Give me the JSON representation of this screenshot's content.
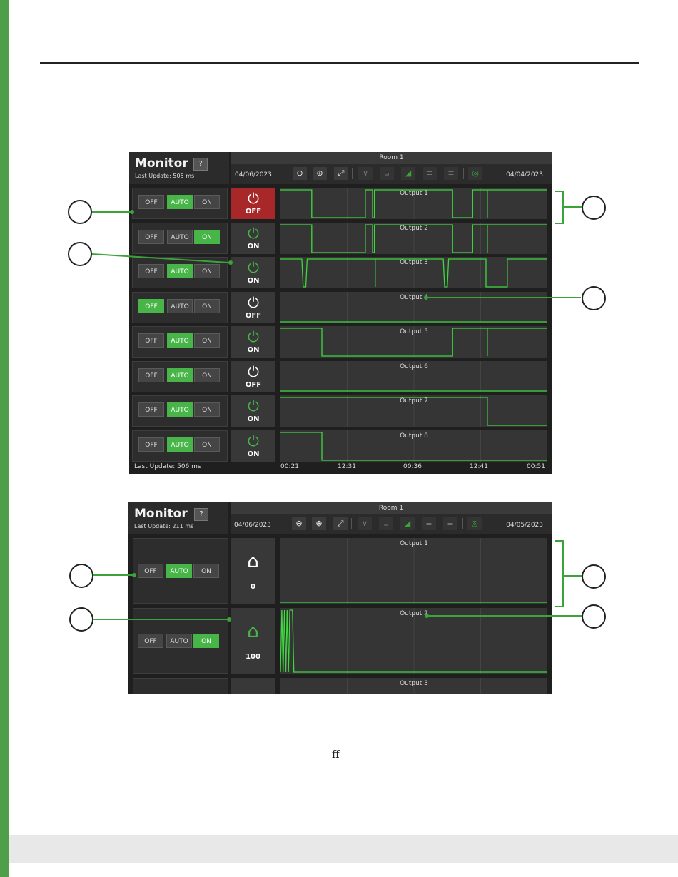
{
  "page": {
    "footer_text": "ff"
  },
  "monitor1": {
    "title": "Monitor",
    "help": "?",
    "last_update_top": "Last Update:  505 ms",
    "room": "Room 1",
    "date_left": "04/06/2023",
    "date_right": "04/04/2023",
    "last_update_bottom": "Last Update:  506 ms",
    "toolbar": [
      "zoom-out-icon",
      "zoom-in-icon",
      "fit-icon",
      "chart-line-icon",
      "chart-step-icon",
      "chart-area-icon",
      "list-icon",
      "legend-icon",
      "camera-icon"
    ],
    "x_ticks": [
      "00:21",
      "12:31",
      "00:36",
      "12:41",
      "00:51"
    ],
    "outputs": [
      {
        "name": "Output 1",
        "mode": "AUTO",
        "status": "OFF",
        "state": "off-red",
        "signal": [
          [
            0,
            1
          ],
          [
            0.117,
            1
          ],
          [
            0.117,
            0
          ],
          [
            0.318,
            0
          ],
          [
            0.318,
            1
          ],
          [
            0.345,
            1
          ],
          [
            0.345,
            0
          ],
          [
            0.352,
            0
          ],
          [
            0.352,
            1
          ],
          [
            0.645,
            1
          ],
          [
            0.645,
            0
          ],
          [
            0.72,
            0
          ],
          [
            0.72,
            1
          ],
          [
            0.775,
            1
          ],
          [
            0.775,
            0
          ],
          [
            0.775,
            1
          ],
          [
            1,
            1
          ]
        ]
      },
      {
        "name": "Output 2",
        "mode": "ON",
        "status": "ON",
        "state": "on",
        "signal": [
          [
            0,
            1
          ],
          [
            0.117,
            1
          ],
          [
            0.117,
            0
          ],
          [
            0.318,
            0
          ],
          [
            0.318,
            1
          ],
          [
            0.345,
            1
          ],
          [
            0.345,
            0
          ],
          [
            0.352,
            0
          ],
          [
            0.352,
            1
          ],
          [
            0.645,
            1
          ],
          [
            0.645,
            0
          ],
          [
            0.72,
            0
          ],
          [
            0.72,
            1
          ],
          [
            0.775,
            1
          ],
          [
            0.775,
            0
          ],
          [
            0.775,
            1
          ],
          [
            1,
            1
          ]
        ]
      },
      {
        "name": "Output 3",
        "mode": "AUTO",
        "status": "ON",
        "state": "on",
        "signal": [
          [
            0,
            1
          ],
          [
            0.08,
            1
          ],
          [
            0.085,
            0
          ],
          [
            0.095,
            0
          ],
          [
            0.1,
            1
          ],
          [
            0.355,
            1
          ],
          [
            0.355,
            0
          ],
          [
            0.355,
            1
          ],
          [
            0.61,
            1
          ],
          [
            0.615,
            0
          ],
          [
            0.625,
            0
          ],
          [
            0.63,
            1
          ],
          [
            0.77,
            1
          ],
          [
            0.77,
            0
          ],
          [
            0.85,
            0
          ],
          [
            0.85,
            1
          ],
          [
            1,
            1
          ]
        ]
      },
      {
        "name": "Output 4",
        "mode": "OFF",
        "status": "OFF",
        "state": "off",
        "signal": [
          [
            0,
            0
          ],
          [
            1,
            0
          ]
        ]
      },
      {
        "name": "Output 5",
        "mode": "AUTO",
        "status": "ON",
        "state": "on",
        "signal": [
          [
            0,
            1
          ],
          [
            0.155,
            1
          ],
          [
            0.155,
            0
          ],
          [
            0.645,
            0
          ],
          [
            0.645,
            1
          ],
          [
            0.775,
            1
          ],
          [
            0.775,
            0
          ],
          [
            0.775,
            1
          ],
          [
            1,
            1
          ]
        ]
      },
      {
        "name": "Output 6",
        "mode": "AUTO",
        "status": "OFF",
        "state": "off",
        "signal": [
          [
            0,
            0
          ],
          [
            1,
            0
          ]
        ]
      },
      {
        "name": "Output 7",
        "mode": "AUTO",
        "status": "ON",
        "state": "on",
        "signal": [
          [
            0,
            1
          ],
          [
            0.775,
            1
          ],
          [
            0.775,
            0
          ],
          [
            1,
            0
          ]
        ]
      },
      {
        "name": "Output 8",
        "mode": "AUTO",
        "status": "ON",
        "state": "on",
        "signal": [
          [
            0,
            1
          ],
          [
            0.155,
            1
          ],
          [
            0.155,
            0
          ],
          [
            1,
            0
          ]
        ]
      }
    ]
  },
  "monitor2": {
    "title": "Monitor",
    "help": "?",
    "last_update_top": "Last Update:  211 ms",
    "room": "Room 1",
    "date_left": "04/06/2023",
    "date_right": "04/05/2023",
    "toolbar": [
      "zoom-out-icon",
      "zoom-in-icon",
      "fit-icon",
      "chart-line-icon",
      "chart-step-icon",
      "chart-area-icon",
      "list-icon",
      "legend-icon",
      "camera-icon"
    ],
    "outputs": [
      {
        "name": "Output 1",
        "mode": "AUTO",
        "value": "0",
        "state": "off",
        "signal": [
          [
            0,
            0
          ],
          [
            1,
            0
          ]
        ]
      },
      {
        "name": "Output 2",
        "mode": "ON",
        "value": "100",
        "state": "on",
        "signal": [
          [
            0,
            0
          ],
          [
            0.005,
            1
          ],
          [
            0.01,
            0
          ],
          [
            0.015,
            1
          ],
          [
            0.02,
            0
          ],
          [
            0.025,
            1
          ],
          [
            0.03,
            0
          ],
          [
            0.035,
            1
          ],
          [
            0.045,
            1
          ],
          [
            0.05,
            0
          ],
          [
            1,
            0
          ]
        ]
      },
      {
        "name": "Output 3",
        "mode": "",
        "value": "",
        "state": "off",
        "signal": []
      }
    ]
  },
  "labels": {
    "off": "OFF",
    "auto": "AUTO",
    "on": "ON"
  },
  "colors": {
    "accent_green": "#48b548",
    "off_red": "#a8282a",
    "signal": "#3fd63f"
  }
}
